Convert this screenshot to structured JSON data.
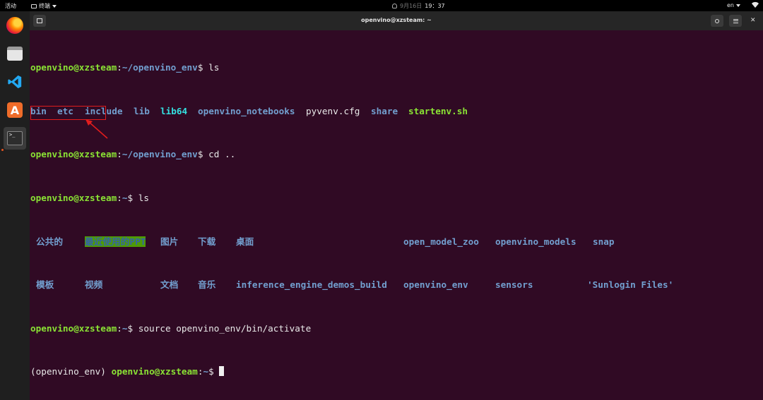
{
  "topbar": {
    "activities": "活动",
    "app_menu": "终端",
    "date": "9月16日",
    "time": "19：37",
    "lang": "en"
  },
  "window": {
    "title": "openvino@xzsteam: ~"
  },
  "terminal": {
    "lines": [
      {
        "user": "openvino@xzsteam",
        "sep": ":",
        "path": "~/openvino_env",
        "prompt": "$ ",
        "cmd": "ls"
      },
      {
        "user": "openvino@xzsteam",
        "sep": ":",
        "path": "~/openvino_env",
        "prompt": "$ ",
        "cmd": "cd .."
      },
      {
        "user": "openvino@xzsteam",
        "sep": ":",
        "path": "~",
        "prompt": "$ ",
        "cmd": "ls"
      },
      {
        "user": "openvino@xzsteam",
        "sep": ":",
        "path": "~",
        "prompt": "$ ",
        "cmd": "source openvino_env/bin/activate"
      }
    ],
    "ls_env": [
      "bin",
      "etc",
      "include",
      "lib",
      "lib64",
      "openvino_notebooks",
      "pyvenv.cfg",
      "share",
      "startenv.sh"
    ],
    "ls_home_row1": [
      "公共的",
      "最近使用的PPT",
      "图片",
      "下载",
      "桌面",
      "open_model_zoo",
      "openvino_models",
      "snap"
    ],
    "ls_home_row2": [
      "模板",
      "视频",
      "文档",
      "音乐",
      "inference_engine_demos_build",
      "openvino_env",
      "sensors",
      "'Sunlogin Files'"
    ],
    "venv": "(openvino_env)",
    "final_prompt": {
      "user": "openvino@xzsteam",
      "sep": ":",
      "path": "~",
      "prompt": "$ "
    }
  },
  "colors": {
    "bg": "#300a24",
    "prompt_user": "#8ae234",
    "prompt_path": "#729fcf",
    "annotation": "#e11d1d"
  }
}
